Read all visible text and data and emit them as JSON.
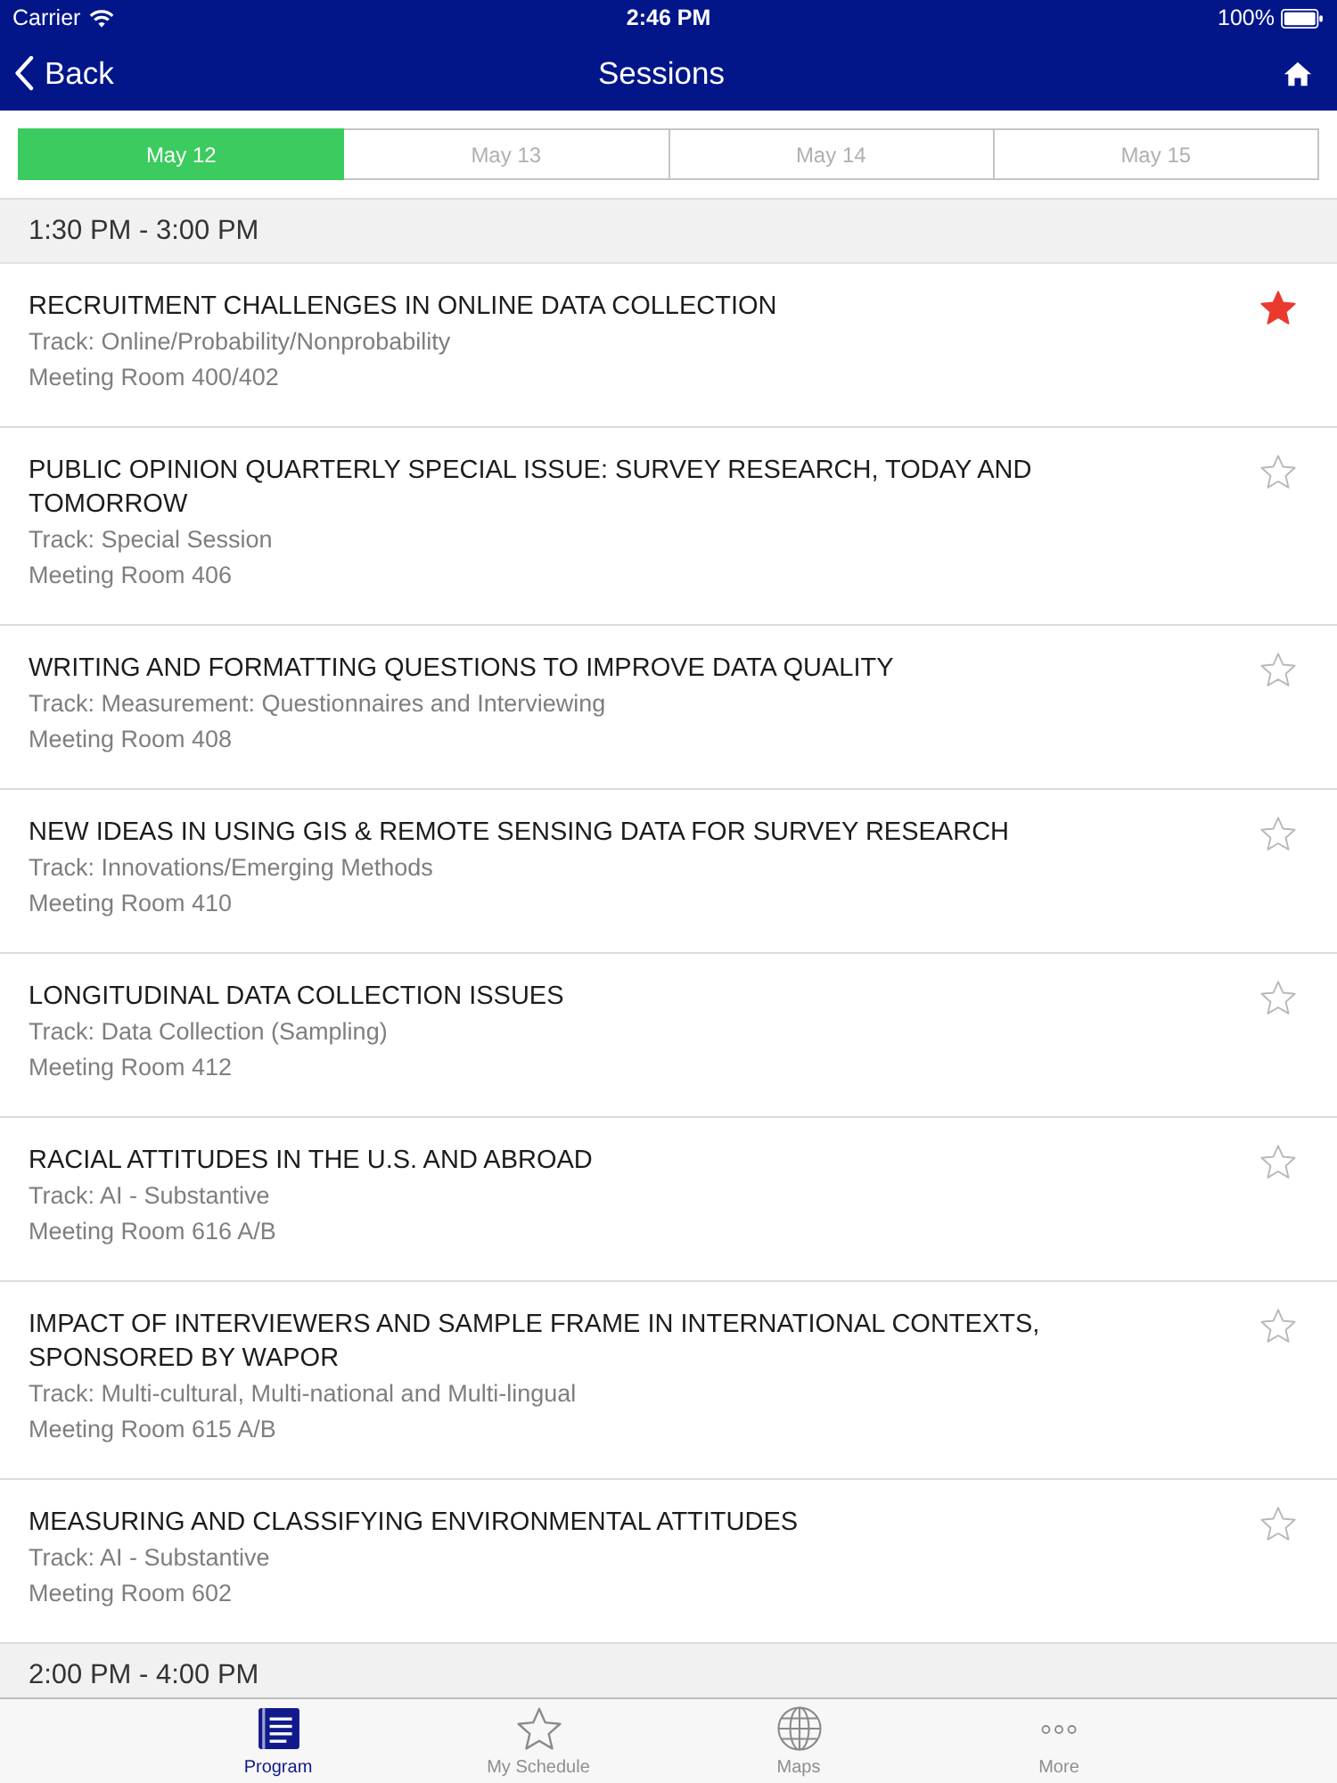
{
  "status_bar": {
    "carrier": "Carrier",
    "time": "2:46 PM",
    "battery": "100%"
  },
  "nav_bar": {
    "back": "Back",
    "title": "Sessions"
  },
  "date_tabs": [
    {
      "label": "May 12",
      "selected": true
    },
    {
      "label": "May 13",
      "selected": false
    },
    {
      "label": "May 14",
      "selected": false
    },
    {
      "label": "May 15",
      "selected": false
    }
  ],
  "sections": [
    {
      "time": "1:30 PM - 3:00 PM",
      "sessions": [
        {
          "title": "RECRUITMENT CHALLENGES IN ONLINE DATA COLLECTION",
          "track": "Track: Online/Probability/Nonprobability",
          "room": "Meeting Room 400/402",
          "starred": true
        },
        {
          "title": "PUBLIC OPINION QUARTERLY SPECIAL ISSUE: SURVEY RESEARCH, TODAY AND TOMORROW",
          "track": "Track: Special Session",
          "room": "Meeting Room 406",
          "starred": false
        },
        {
          "title": "WRITING AND FORMATTING QUESTIONS TO IMPROVE DATA QUALITY",
          "track": "Track: Measurement: Questionnaires and Interviewing",
          "room": "Meeting Room 408",
          "starred": false
        },
        {
          "title": "NEW IDEAS IN USING GIS & REMOTE SENSING DATA FOR SURVEY RESEARCH",
          "track": "Track: Innovations/Emerging Methods",
          "room": "Meeting Room 410",
          "starred": false
        },
        {
          "title": "LONGITUDINAL DATA COLLECTION ISSUES",
          "track": "Track: Data Collection (Sampling)",
          "room": "Meeting Room 412",
          "starred": false
        },
        {
          "title": "RACIAL ATTITUDES IN THE U.S. AND ABROAD",
          "track": "Track: AI - Substantive",
          "room": "Meeting Room 616 A/B",
          "starred": false
        },
        {
          "title": "IMPACT OF INTERVIEWERS AND SAMPLE FRAME IN INTERNATIONAL CONTEXTS, SPONSORED BY WAPOR",
          "track": "Track: Multi-cultural, Multi-national and Multi-lingual",
          "room": "Meeting Room 615 A/B",
          "starred": false
        },
        {
          "title": "MEASURING AND CLASSIFYING ENVIRONMENTAL ATTITUDES",
          "track": "Track: AI - Substantive",
          "room": "Meeting Room 602",
          "starred": false
        }
      ]
    },
    {
      "time": "2:00 PM - 4:00 PM"
    }
  ],
  "tab_bar": [
    {
      "kind": "program",
      "label": "Program",
      "selected": true
    },
    {
      "kind": "schedule",
      "label": "My Schedule",
      "selected": false
    },
    {
      "kind": "maps",
      "label": "Maps",
      "selected": false
    },
    {
      "kind": "more",
      "label": "More",
      "selected": false
    }
  ]
}
